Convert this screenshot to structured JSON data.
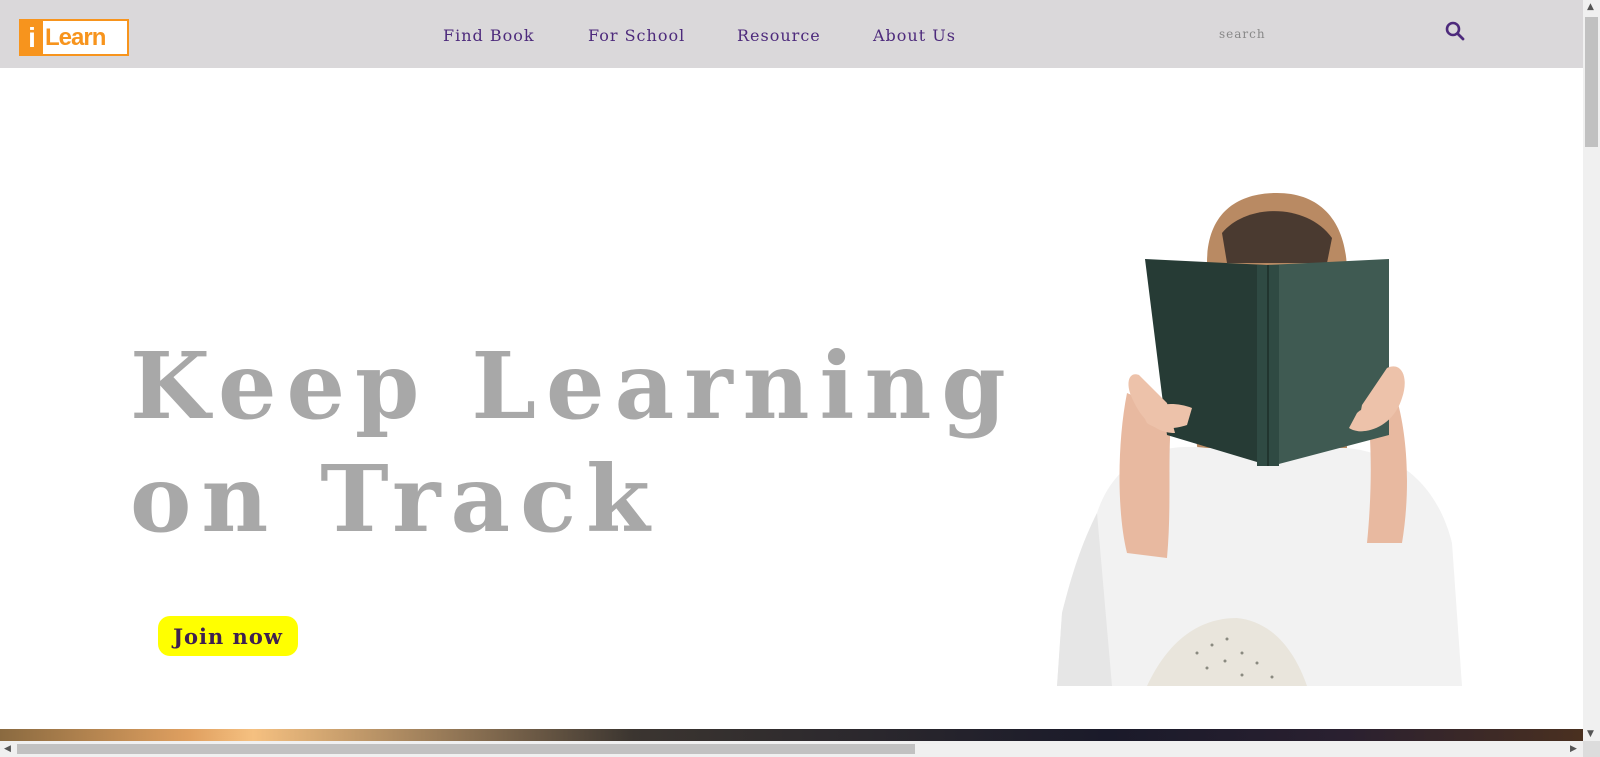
{
  "brand": {
    "logo_i": "i",
    "logo_rest": "Learn"
  },
  "nav": {
    "items": [
      {
        "label": "Find Book"
      },
      {
        "label": "For School"
      },
      {
        "label": "Resource"
      },
      {
        "label": "About Us"
      }
    ],
    "search_placeholder": "search",
    "search_icon": "search-icon"
  },
  "hero": {
    "title_line1": "Keep Learning",
    "title_line2": "on Track",
    "cta_label": "Join now",
    "image": "woman-reading-book-photo"
  },
  "colors": {
    "navbar_bg": "#dad8da",
    "nav_text": "#4d2a7c",
    "logo_orange": "#f7941d",
    "hero_title": "#a8a8a8",
    "cta_bg": "#ffff00",
    "cta_text": "#3e2050"
  },
  "scroll": {
    "horizontal_fraction": 0.58,
    "vertical_position": 0
  }
}
